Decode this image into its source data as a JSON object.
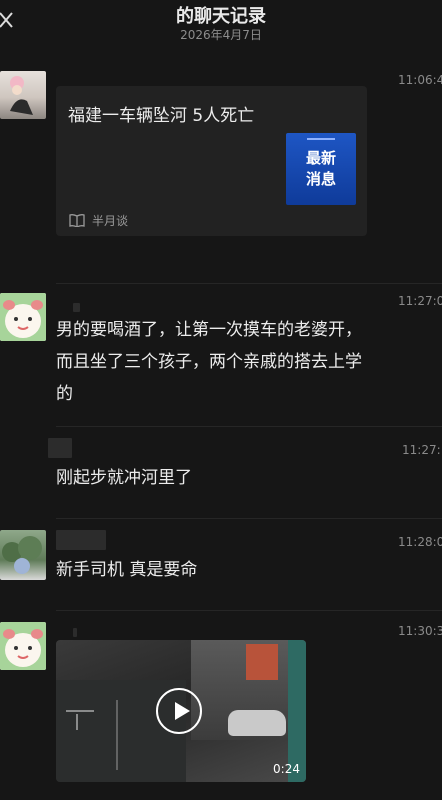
{
  "header": {
    "title": "的聊天记录",
    "date": "2026年4月7日"
  },
  "messages": [
    {
      "time": "11:06:4",
      "card": {
        "title": "福建一车辆坠河  5人死亡",
        "thumb_line1": "最新",
        "thumb_line2": "消息",
        "source": "半月谈"
      }
    },
    {
      "time": "11:27:0",
      "text_lines": [
        "男的要喝酒了，让第一次摸车的老婆开，",
        "而且坐了三个孩子，两个亲戚的搭去上学",
        "的"
      ]
    },
    {
      "time": "11:27:",
      "text": "刚起步就冲河里了"
    },
    {
      "time": "11:28:0",
      "text": "新手司机   真是要命"
    },
    {
      "time": "11:30:3",
      "video": {
        "duration": "0:24"
      }
    }
  ]
}
